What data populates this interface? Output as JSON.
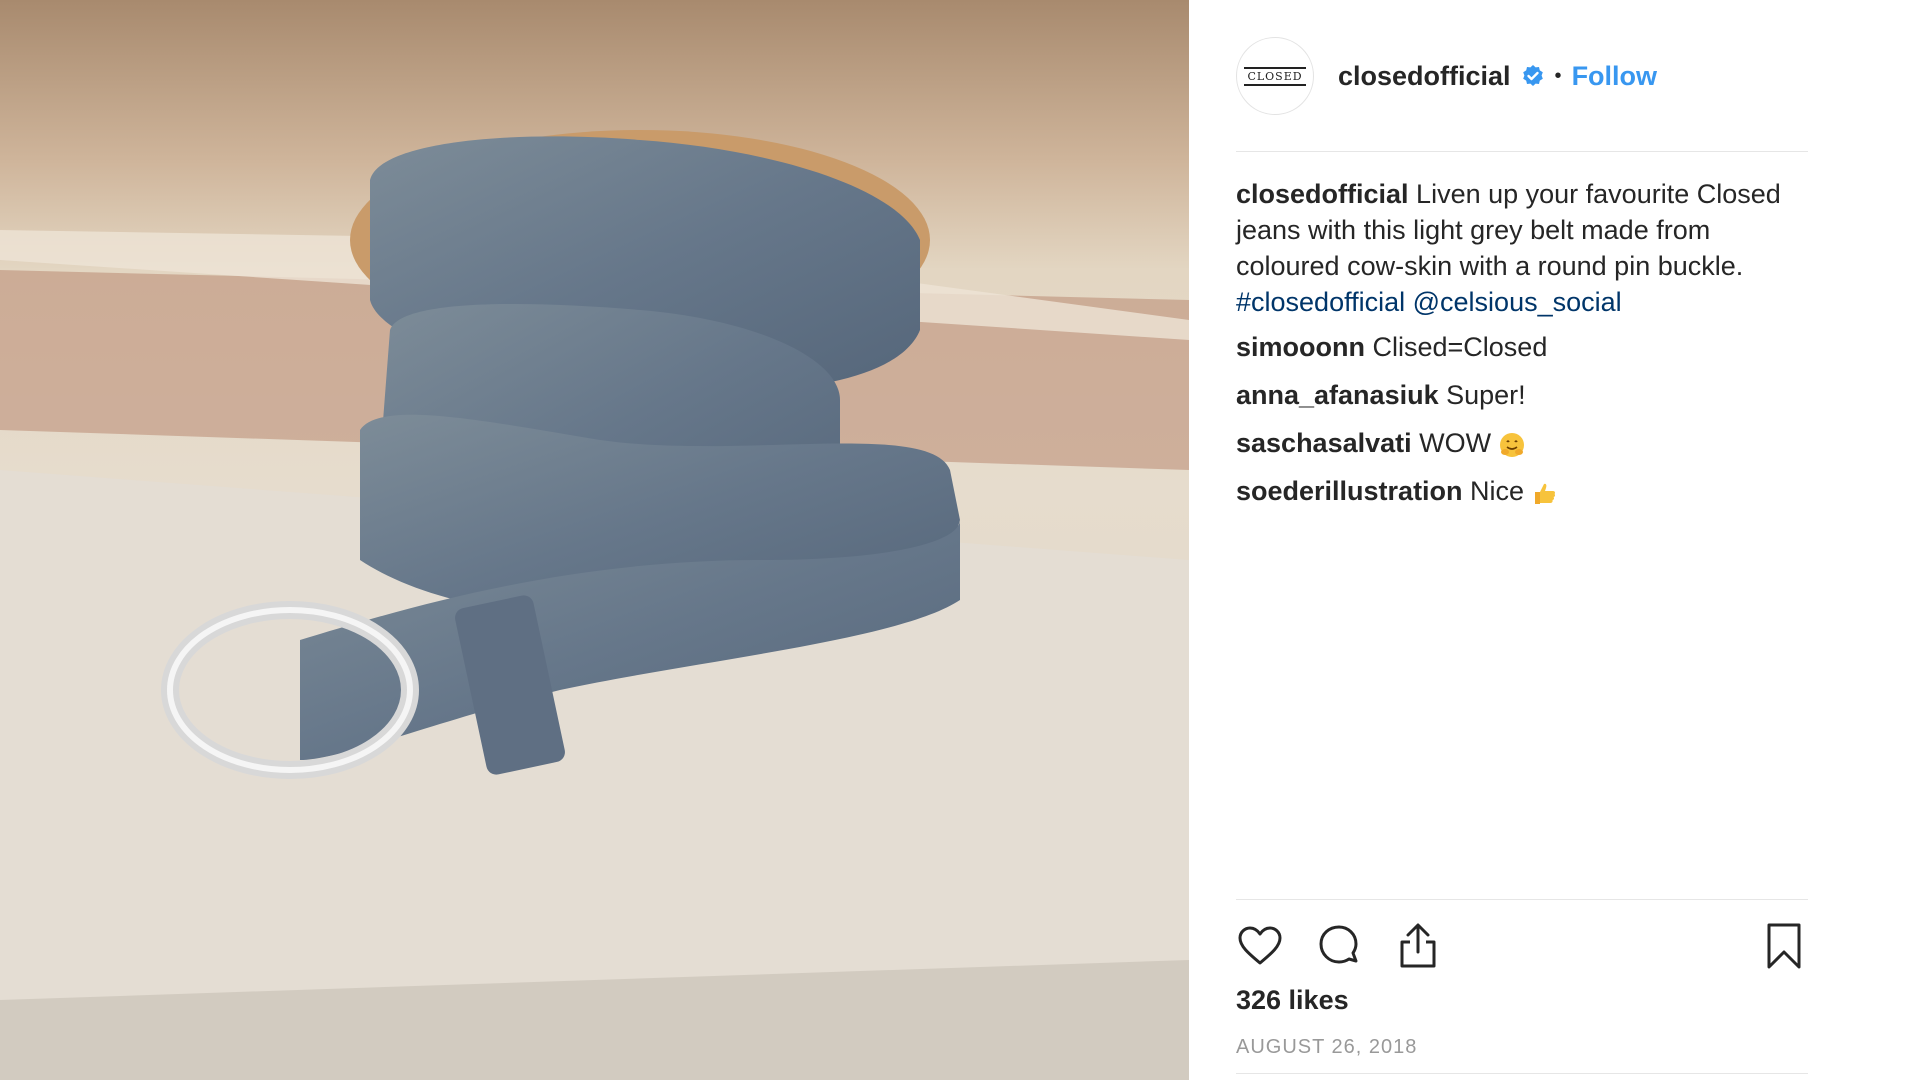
{
  "post": {
    "author": "closedofficial",
    "avatar_logo_text": "CLOSED",
    "verified_icon": "verified-badge-icon",
    "separator": "•",
    "follow_label": "Follow",
    "caption_author": "closedofficial",
    "caption_text": " Liven up your favourite Closed jeans with this light grey belt made from coloured cow-skin with a round pin buckle. ",
    "caption_hashtag": "#closedofficial",
    "caption_mention": "@celsious_social",
    "photo": "grey-cowskin-belt-with-round-buckle-photo",
    "comments": [
      {
        "user": "simooonn",
        "text": " Clised=Closed",
        "emoji": ""
      },
      {
        "user": "anna_afanasiuk",
        "text": " Super!",
        "emoji": ""
      },
      {
        "user": "saschasalvati",
        "text": " WOW ",
        "emoji": "hugging-face-emoji"
      },
      {
        "user": "soederillustration",
        "text": " Nice ",
        "emoji": "thumbs-up-emoji"
      }
    ],
    "likes": "326 likes",
    "date": "AUGUST 26, 2018",
    "colors": {
      "follow": "#3897f0",
      "link": "#003569",
      "text": "#262626",
      "muted": "#999999"
    }
  }
}
